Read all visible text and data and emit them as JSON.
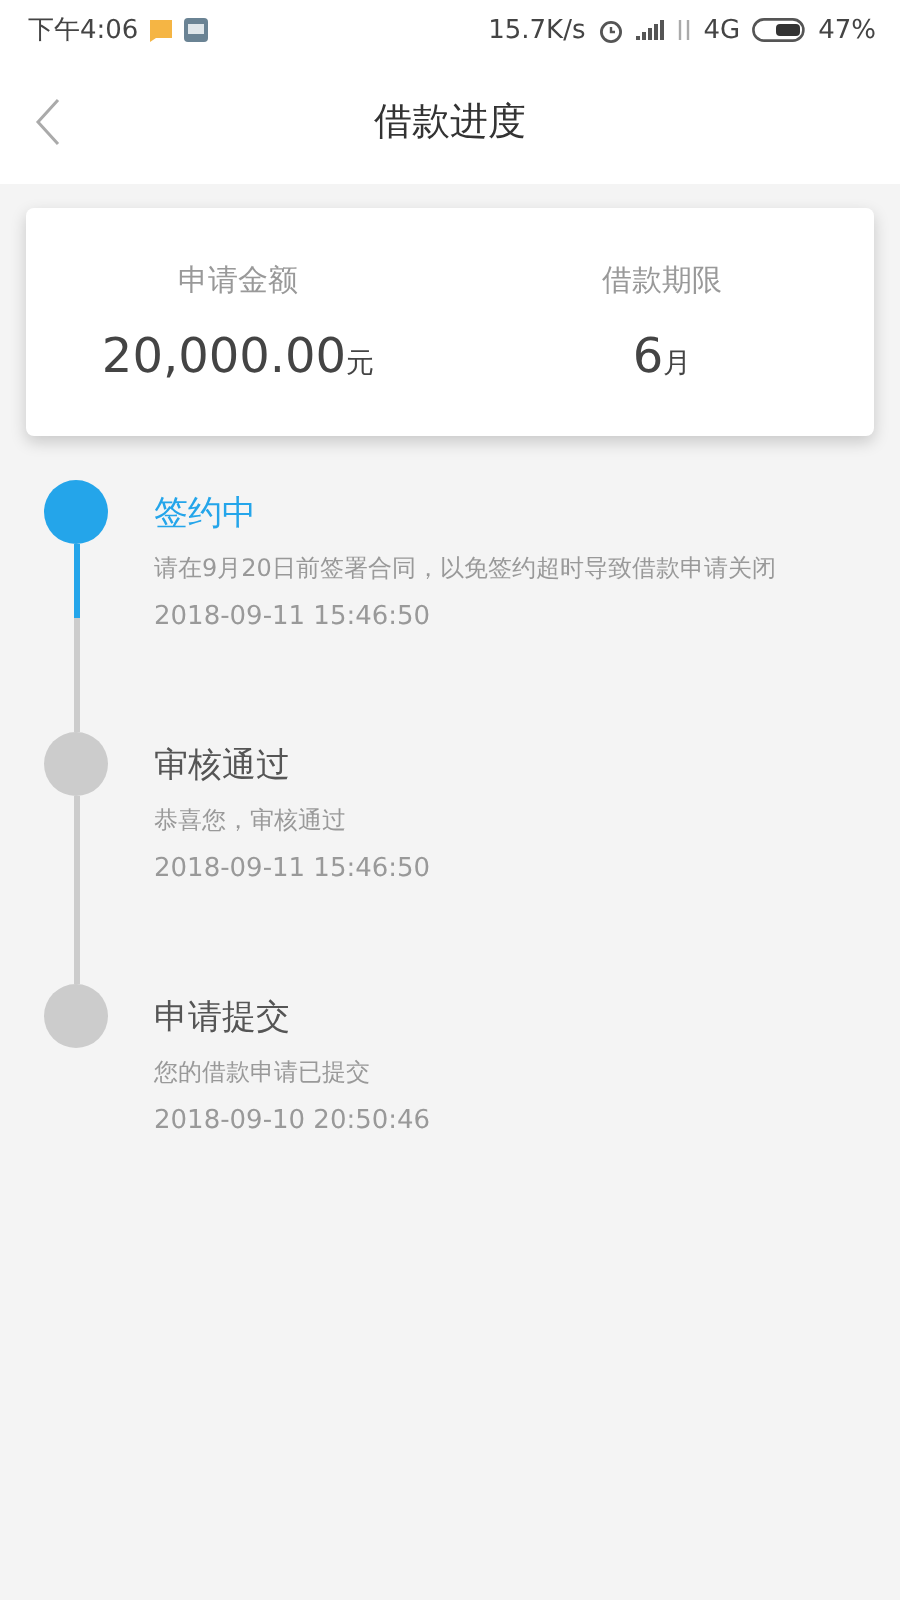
{
  "status_bar": {
    "time": "下午4:06",
    "speed": "15.7K/s",
    "network": "4G",
    "battery": "47%"
  },
  "header": {
    "title": "借款进度"
  },
  "summary": [
    {
      "label": "申请金额",
      "value": "20,000.00",
      "unit": "元"
    },
    {
      "label": "借款期限",
      "value": "6",
      "unit": "月"
    }
  ],
  "steps": [
    {
      "title": "签约中",
      "description": "请在9月20日前签署合同，以免签约超时导致借款申请关闭",
      "time": "2018-09-11 15:46:50",
      "selected": true
    },
    {
      "title": "审核通过",
      "description": "恭喜您，审核通过",
      "time": "2018-09-11 15:46:50",
      "selected": false
    },
    {
      "title": "申请提交",
      "description": "您的借款申请已提交",
      "time": "2018-09-10 20:50:46",
      "selected": false
    }
  ]
}
